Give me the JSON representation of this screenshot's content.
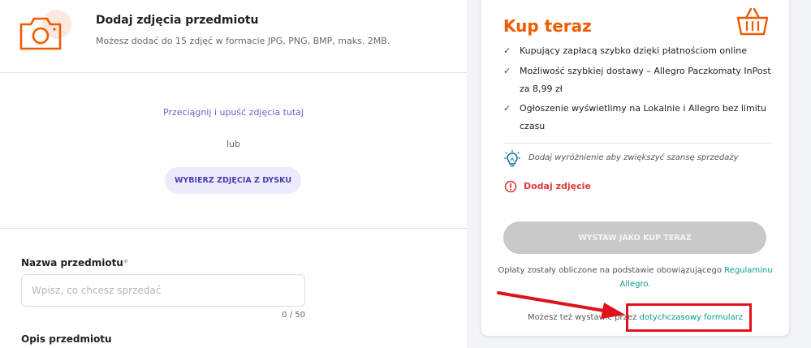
{
  "photos": {
    "title": "Dodaj zdjęcia przedmiotu",
    "subtitle": "Możesz dodać do 15 zdjęć w formacie JPG, PNG, BMP, maks. 2MB.",
    "drop_text": "Przeciągnij i upuść zdjęcia tutaj",
    "or_text": "lub",
    "pick_button": "WYBIERZ ZDJĘCIA Z DYSKU"
  },
  "item": {
    "name_label": "Nazwa przedmiotu",
    "required_mark": "*",
    "name_placeholder": "Wpisz, co chcesz sprzedać",
    "name_value": "",
    "counter": "0 / 50",
    "description_label": "Opis przedmiotu"
  },
  "buy_now": {
    "title": "Kup teraz",
    "features": [
      "Kupujący zapłacą szybko dzięki płatnościom online",
      "Możliwość szybkiej dostawy – Allegro Paczkomaty InPost za 8,99 zł",
      "Ogłoszenie wyświetlimy na Lokalnie i Allegro bez limitu czasu"
    ],
    "tip": "Dodaj wyróżnienie aby zwiększyć szansę sprzedaży",
    "error": "Dodaj zdjęcie",
    "list_button": "WYSTAW JAKO KUP TERAZ",
    "fees_text": "Opłaty zostały obliczone na podstawie obowiązującego",
    "fees_link": "Regulaminu Allegro.",
    "alt_text": "Możesz też wystawić przez",
    "alt_link": "dotychczasowy formularz"
  },
  "colors": {
    "accent": "#f05a00",
    "error": "#e03a3a",
    "link": "#0a9b8e",
    "annotation": "#e0121b"
  },
  "icons": [
    "camera-icon",
    "basket-icon",
    "check-icon",
    "lightbulb-icon",
    "alert-icon",
    "arrow-annotation"
  ]
}
